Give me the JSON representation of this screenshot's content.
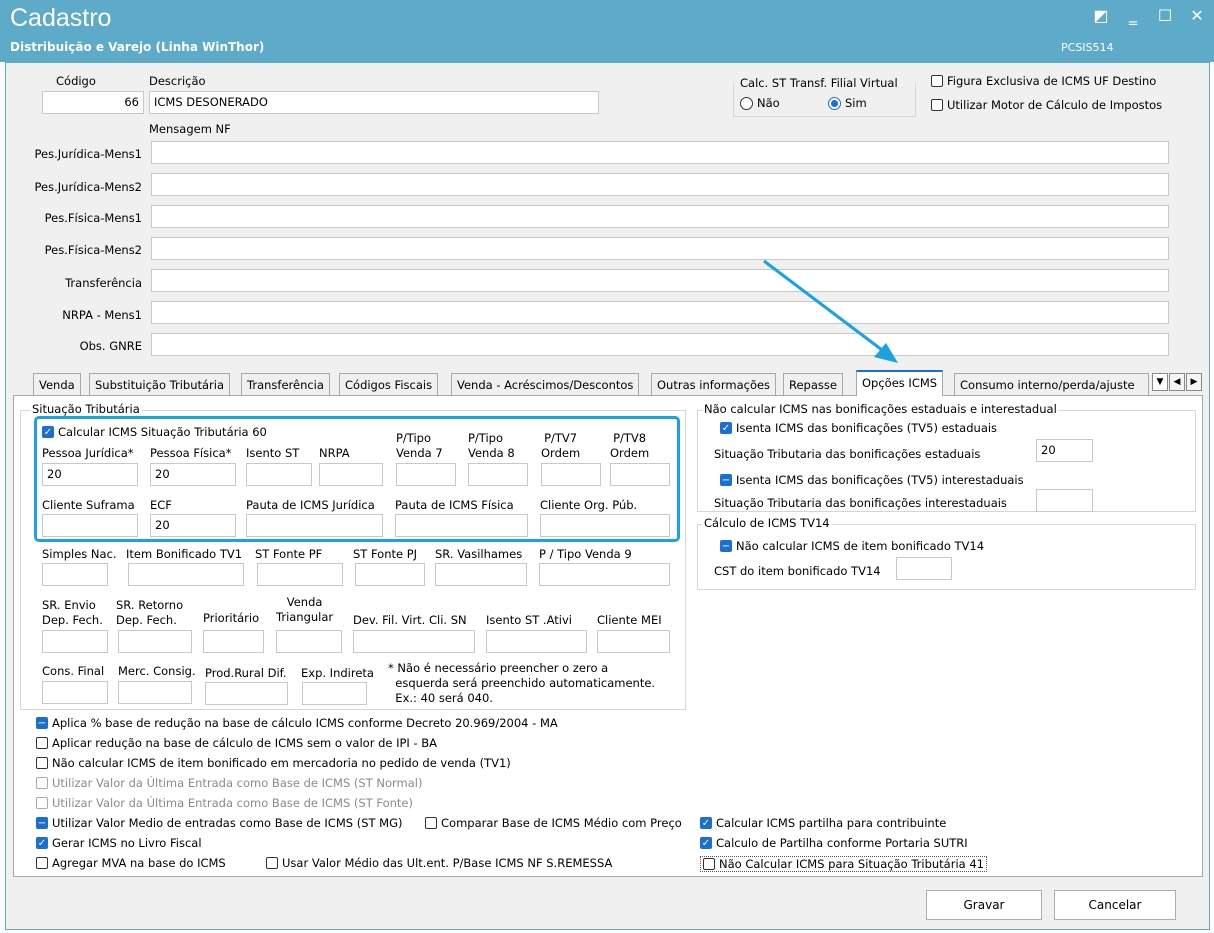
{
  "window": {
    "title": "Cadastro",
    "subtitle": "Distribuição e Varejo (Linha WinThor)",
    "routine": "PCSIS514",
    "controls": [
      "◩",
      "‗",
      "☐",
      "✕"
    ]
  },
  "header": {
    "codigo_label": "Código",
    "codigo_value": "66",
    "descricao_label": "Descrição",
    "descricao_value": "ICMS DESONERADO",
    "mensagem_label": "Mensagem NF",
    "calc_st_label": "Calc. ST Transf. Filial Virtual",
    "radio_nao": "Não",
    "radio_sim": "Sim",
    "figura_exclusiva": "Figura Exclusiva de ICMS UF Destino",
    "motor_calculo": "Utilizar Motor de Cálculo de Impostos"
  },
  "messages": [
    {
      "label": "Pes.Jurídica-Mens1",
      "value": ""
    },
    {
      "label": "Pes.Jurídica-Mens2",
      "value": ""
    },
    {
      "label": "Pes.Física-Mens1",
      "value": ""
    },
    {
      "label": "Pes.Física-Mens2",
      "value": ""
    },
    {
      "label": "Transferência",
      "value": ""
    },
    {
      "label": "NRPA - Mens1",
      "value": ""
    },
    {
      "label": "Obs. GNRE",
      "value": ""
    }
  ],
  "tabs": [
    "Venda",
    "Substituição Tributária",
    "Transferência",
    "Códigos Fiscais",
    "Venda - Acréscimos/Descontos",
    "Outras informações",
    "Repasse",
    "Opções ICMS",
    "Consumo interno/perda/ajuste"
  ],
  "situacao": {
    "group_label": "Situação Tributária",
    "calc_60": "Calcular ICMS Situação Tributária 60",
    "pessoa_juridica": "Pessoa Jurídica*",
    "pessoa_juridica_value": "20",
    "pessoa_fisica": "Pessoa Física*",
    "pessoa_fisica_value": "20",
    "isento_st": "Isento ST",
    "nrpa": "NRPA",
    "p_tipo_venda7": "P/Tipo\nVenda 7",
    "p_tipo_venda8": "P/Tipo\nVenda 8",
    "p_tv7": "P/TV7\nOrdem",
    "p_tv8": "P/TV8\nOrdem",
    "cliente_suframa": "Cliente Suframa",
    "ecf": "ECF",
    "ecf_value": "20",
    "pauta_juridica": "Pauta de ICMS Jurídica",
    "pauta_fisica": "Pauta de ICMS Física",
    "cliente_org": "Cliente Org. Púb.",
    "simples": "Simples Nac.",
    "item_bonificado": "Item Bonificado TV1",
    "st_fonte_pf": "ST Fonte PF",
    "st_fonte_pj": "ST Fonte PJ",
    "sr_vasilhames": "SR. Vasilhames",
    "p_tipo_venda9": "P / Tipo Venda 9",
    "sr_envio": "SR. Envio\nDep. Fech.",
    "sr_retorno": "SR. Retorno\nDep. Fech.",
    "prioritario": "Prioritário",
    "venda_triangular": "Venda\nTriangular",
    "dev_fil": "Dev. Fil. Virt. Cli. SN",
    "isento_st_ativi": "Isento ST .Ativi",
    "cliente_mei": "Cliente MEI",
    "cons_final": "Cons. Final",
    "merc_consig": "Merc. Consig.",
    "prod_rural": "Prod.Rural Dif.",
    "exp_indireta": "Exp. Indireta",
    "note": "* Não é necessário preencher o zero a\n  esquerda será preenchido automaticamente.\n  Ex.: 40 será 040."
  },
  "bonificacoes": {
    "group_label": "Não calcular ICMS nas bonificações estaduais e interestadual",
    "isenta_estaduais": "Isenta ICMS das bonificações (TV5) estaduais",
    "sit_estaduais_label": "Situação Tributaria das  bonificações estaduais",
    "sit_estaduais_value": "20",
    "isenta_interestaduais": "Isenta ICMS das bonificações (TV5) interestaduais",
    "sit_interestaduais_label": "Situação Tributaria das  bonificações interestaduais",
    "sit_interestaduais_value": ""
  },
  "tv14": {
    "group_label": "Cálculo de ICMS TV14",
    "nao_calcular": "Não calcular ICMS de item bonificado TV14",
    "cst_label": "CST do item bonificado TV14",
    "cst_value": ""
  },
  "options": {
    "aplica_reducao": "Aplica % base de redução na base de cálculo ICMS conforme Decreto 20.969/2004 - MA",
    "aplicar_sem_ipi": "Aplicar redução na base de cálculo de ICMS sem o valor de IPI - BA",
    "nao_calcular_tv1": "Não calcular ICMS de item bonificado em mercadoria no pedido de venda (TV1)",
    "ultima_entrada_normal": "Utilizar Valor da Última Entrada como Base de ICMS (ST Normal)",
    "ultima_entrada_fonte": "Utilizar Valor da Última Entrada como Base de ICMS (ST Fonte)",
    "valor_medio_mg": "Utilizar Valor Medio de entradas como Base de ICMS (ST MG)",
    "comparar_base": "Comparar Base de ICMS Médio com Preço",
    "gerar_livro": "Gerar ICMS no Livro Fiscal",
    "agregar_mva": "Agregar MVA na base do ICMS",
    "usar_valor_medio": "Usar Valor Médio das Ult.ent. P/Base ICMS NF S.REMESSA",
    "partilha_contribuinte": "Calcular ICMS partilha para contribuinte",
    "partilha_sutri": "Calculo de Partilha conforme Portaria SUTRI",
    "nao_calcular_41": "Não Calcular ICMS para Situação Tributária 41"
  },
  "buttons": {
    "gravar": "Gravar",
    "cancelar": "Cancelar"
  },
  "colors": {
    "titlebar": "#5eaac9",
    "accent": "#1a6fd1",
    "highlight": "#1aa3e0"
  }
}
